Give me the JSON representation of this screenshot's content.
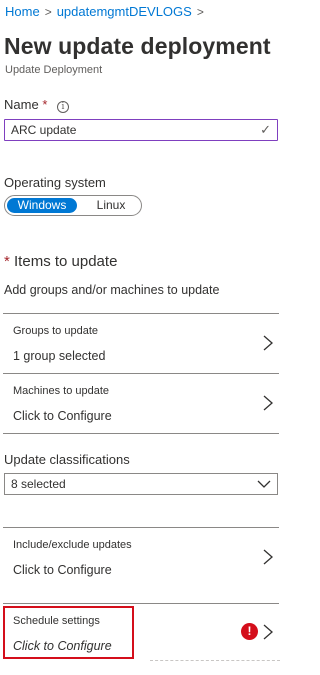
{
  "breadcrumb": {
    "items": [
      "Home",
      "updatemgmtDEVLOGS"
    ],
    "separator": ">"
  },
  "header": {
    "title": "New update deployment",
    "subtitle": "Update Deployment"
  },
  "name_field": {
    "label": "Name",
    "required_marker": "*",
    "info_icon": "i",
    "value": "ARC update",
    "valid_icon": "✓"
  },
  "os_field": {
    "label": "Operating system",
    "options": [
      "Windows",
      "Linux"
    ],
    "selected": "Windows"
  },
  "items_section": {
    "required_marker": "*",
    "title": "Items to update",
    "description": "Add groups and/or machines to update"
  },
  "rows": {
    "groups": {
      "label": "Groups to update",
      "value": "1 group selected"
    },
    "machines": {
      "label": "Machines to update",
      "value": "Click to Configure"
    },
    "include_exclude": {
      "label": "Include/exclude updates",
      "value": "Click to Configure"
    },
    "schedule": {
      "label": "Schedule settings",
      "value": "Click to Configure",
      "error_icon": "!"
    }
  },
  "classifications": {
    "label": "Update classifications",
    "selected_value": "8 selected"
  },
  "colors": {
    "accent": "#0078d4",
    "error": "#d40e1b",
    "valid_border": "#7f3fbf",
    "required": "#a4262c"
  },
  "icons": {
    "chevron": "chevron-right-icon",
    "dropdown": "chevron-down-icon",
    "info": "info-icon",
    "error": "error-icon",
    "check": "check-icon"
  }
}
